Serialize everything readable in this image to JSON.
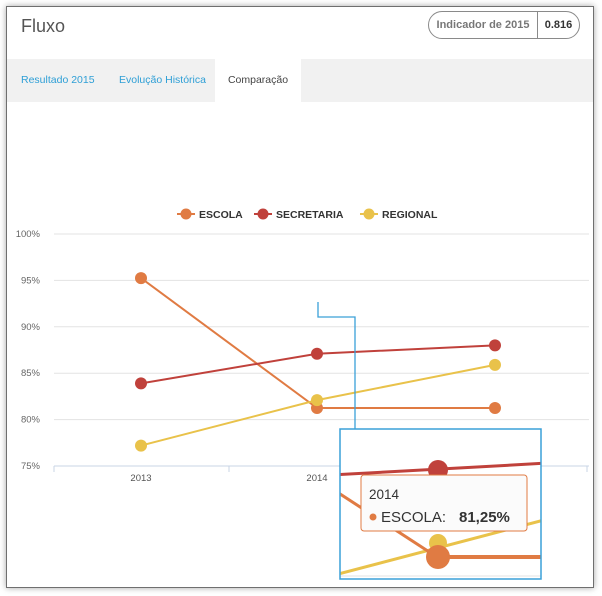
{
  "header": {
    "title": "Fluxo",
    "indicator_label": "Indicador de 2015",
    "indicator_value": "0.816"
  },
  "tabs": [
    {
      "label": "Resultado 2015",
      "active": false
    },
    {
      "label": "Evolução Histórica",
      "active": false
    },
    {
      "label": "Comparação",
      "active": true
    }
  ],
  "chart_data": {
    "type": "line",
    "categories": [
      "2013",
      "2014",
      "2015"
    ],
    "series": [
      {
        "name": "ESCOLA",
        "color": "#e07b43",
        "values": [
          95.25,
          81.25,
          81.25
        ]
      },
      {
        "name": "SECRETARIA",
        "color": "#c0413b",
        "values": [
          83.9,
          87.1,
          88.0
        ]
      },
      {
        "name": "REGIONAL",
        "color": "#e9c24a",
        "values": [
          77.2,
          82.1,
          85.9
        ]
      }
    ],
    "y_ticks": [
      "100%",
      "95%",
      "90%",
      "85%",
      "80%",
      "75%"
    ],
    "ylim": [
      75,
      100
    ],
    "grid": true,
    "legend_position": "top-center",
    "tooltip": {
      "category": "2014",
      "series": "ESCOLA",
      "value_label": "81,25%"
    }
  }
}
